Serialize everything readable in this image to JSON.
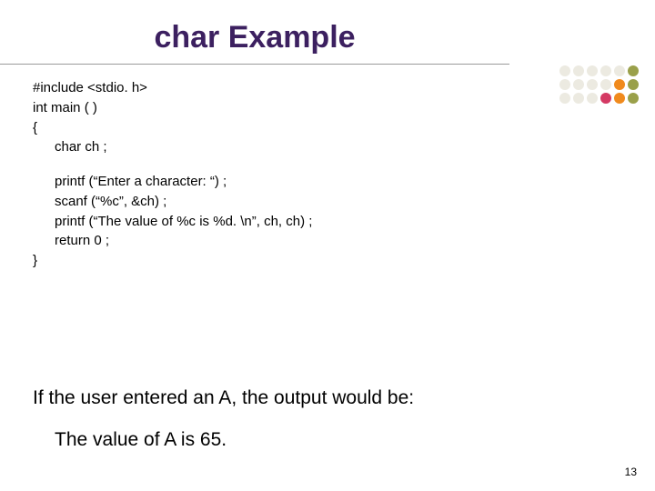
{
  "title": "char Example",
  "code": {
    "l1": "#include <stdio. h>",
    "l2": "int main ( )",
    "l3": "{",
    "l4": "char ch ;",
    "l5": "printf (“Enter a character: “) ;",
    "l6": "scanf (“%c”, &ch) ;",
    "l7": "printf (“The value of %c is %d. \\n”, ch, ch) ;",
    "l8": "return 0 ;",
    "l9": "}"
  },
  "footer": "If the user entered an A, the output would be:",
  "output": "The value of A is 65.",
  "pageNumber": "13",
  "dots": {
    "colors": [
      "#eceae1",
      "#eceae1",
      "#eceae1",
      "#eceae1",
      "#eceae1",
      "#9aa04a",
      "#eceae1",
      "#eceae1",
      "#eceae1",
      "#eceae1",
      "#f08a1d",
      "#9aa04a",
      "#eceae1",
      "#eceae1",
      "#eceae1",
      "#d43a64",
      "#f08a1d",
      "#9aa04a"
    ]
  }
}
